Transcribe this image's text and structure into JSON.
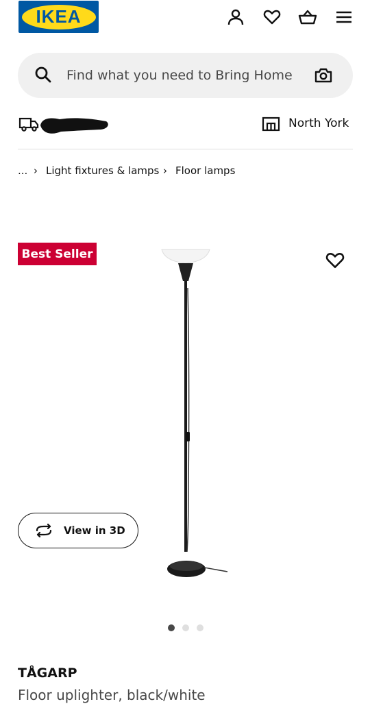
{
  "header": {
    "logo_text": "IKEA",
    "icons": [
      "account-icon",
      "heart-icon",
      "basket-icon",
      "menu-icon"
    ]
  },
  "search": {
    "placeholder": "Find what you need to Bring Home"
  },
  "delivery": {
    "store_name": "North York"
  },
  "breadcrumb": {
    "ellipsis": "...",
    "items": [
      "Light fixtures & lamps",
      "Floor lamps"
    ]
  },
  "product": {
    "badge": "Best Seller",
    "view_3d_label": "View in 3D",
    "carousel": {
      "count": 3,
      "active": 0
    },
    "name": "TÅGARP",
    "description": "Floor uplighter, black/white"
  },
  "colors": {
    "ikea_blue": "#0058a3",
    "ikea_yellow": "#ffda1a",
    "badge_red": "#cc0033",
    "dot_active": "#484848",
    "dot_inactive": "#dfdfdf"
  }
}
